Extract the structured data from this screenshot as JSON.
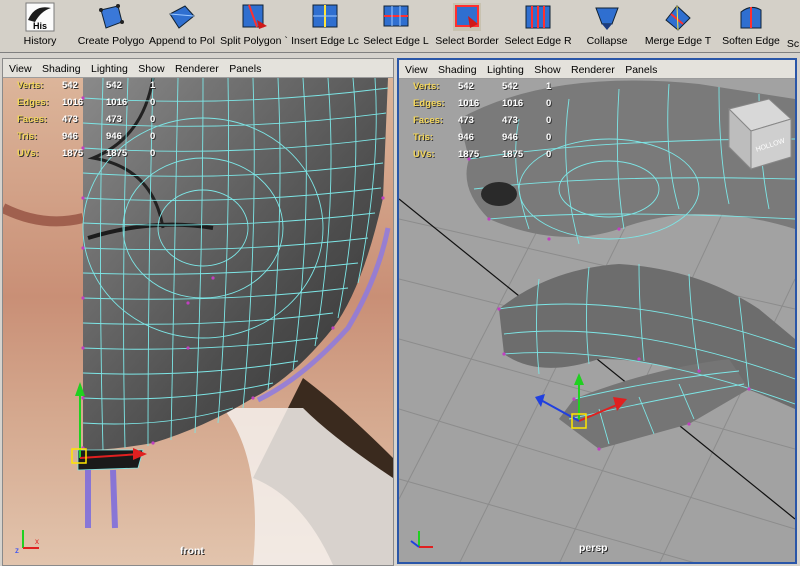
{
  "shelf": {
    "buttons": [
      {
        "name": "history-button",
        "icon": "history-icon",
        "label": "History",
        "icon_text": "His"
      },
      {
        "name": "create-polygon-button",
        "icon": "create-polygon-icon",
        "label": "Create Polygo"
      },
      {
        "name": "append-to-polygon-button",
        "icon": "append-polygon-icon",
        "label": "Append to Pol"
      },
      {
        "name": "split-polygon-button",
        "icon": "split-polygon-icon",
        "label": "Split Polygon `"
      },
      {
        "name": "insert-edge-loop-button",
        "icon": "insert-edge-loop-icon",
        "label": "Insert Edge Lc"
      },
      {
        "name": "select-edge-loop-button",
        "icon": "select-edge-loop-icon",
        "label": "Select Edge L"
      },
      {
        "name": "select-border-button",
        "icon": "select-border-icon",
        "label": "Select Border"
      },
      {
        "name": "select-edge-ring-button",
        "icon": "select-edge-ring-icon",
        "label": "Select Edge R"
      },
      {
        "name": "collapse-button",
        "icon": "collapse-icon",
        "label": "Collapse"
      },
      {
        "name": "merge-edge-button",
        "icon": "merge-edge-icon",
        "label": "Merge Edge T"
      },
      {
        "name": "soften-edge-button",
        "icon": "soften-edge-icon",
        "label": "Soften Edge"
      },
      {
        "name": "more-shelf-button",
        "icon": "more-icon",
        "label": "Sc"
      }
    ]
  },
  "panel_menu": [
    "View",
    "Shading",
    "Lighting",
    "Show",
    "Renderer",
    "Panels"
  ],
  "hud": {
    "rows": [
      {
        "label": "Verts:",
        "a": "542",
        "b": "542",
        "c": "1"
      },
      {
        "label": "Edges:",
        "a": "1016",
        "b": "1016",
        "c": "0"
      },
      {
        "label": "Faces:",
        "a": "473",
        "b": "473",
        "c": "0"
      },
      {
        "label": "Tris:",
        "a": "946",
        "b": "946",
        "c": "0"
      },
      {
        "label": "UVs:",
        "a": "1875",
        "b": "1875",
        "c": "0"
      }
    ]
  },
  "panels": {
    "left": {
      "camera": "front"
    },
    "right": {
      "camera": "persp",
      "viewcube": "HOLLOW"
    }
  },
  "colors": {
    "wireframe": "#7de6e6",
    "vertex": "#c040c0",
    "hud_label": "#f2d55a",
    "active_panel_border": "#2a56a8"
  }
}
